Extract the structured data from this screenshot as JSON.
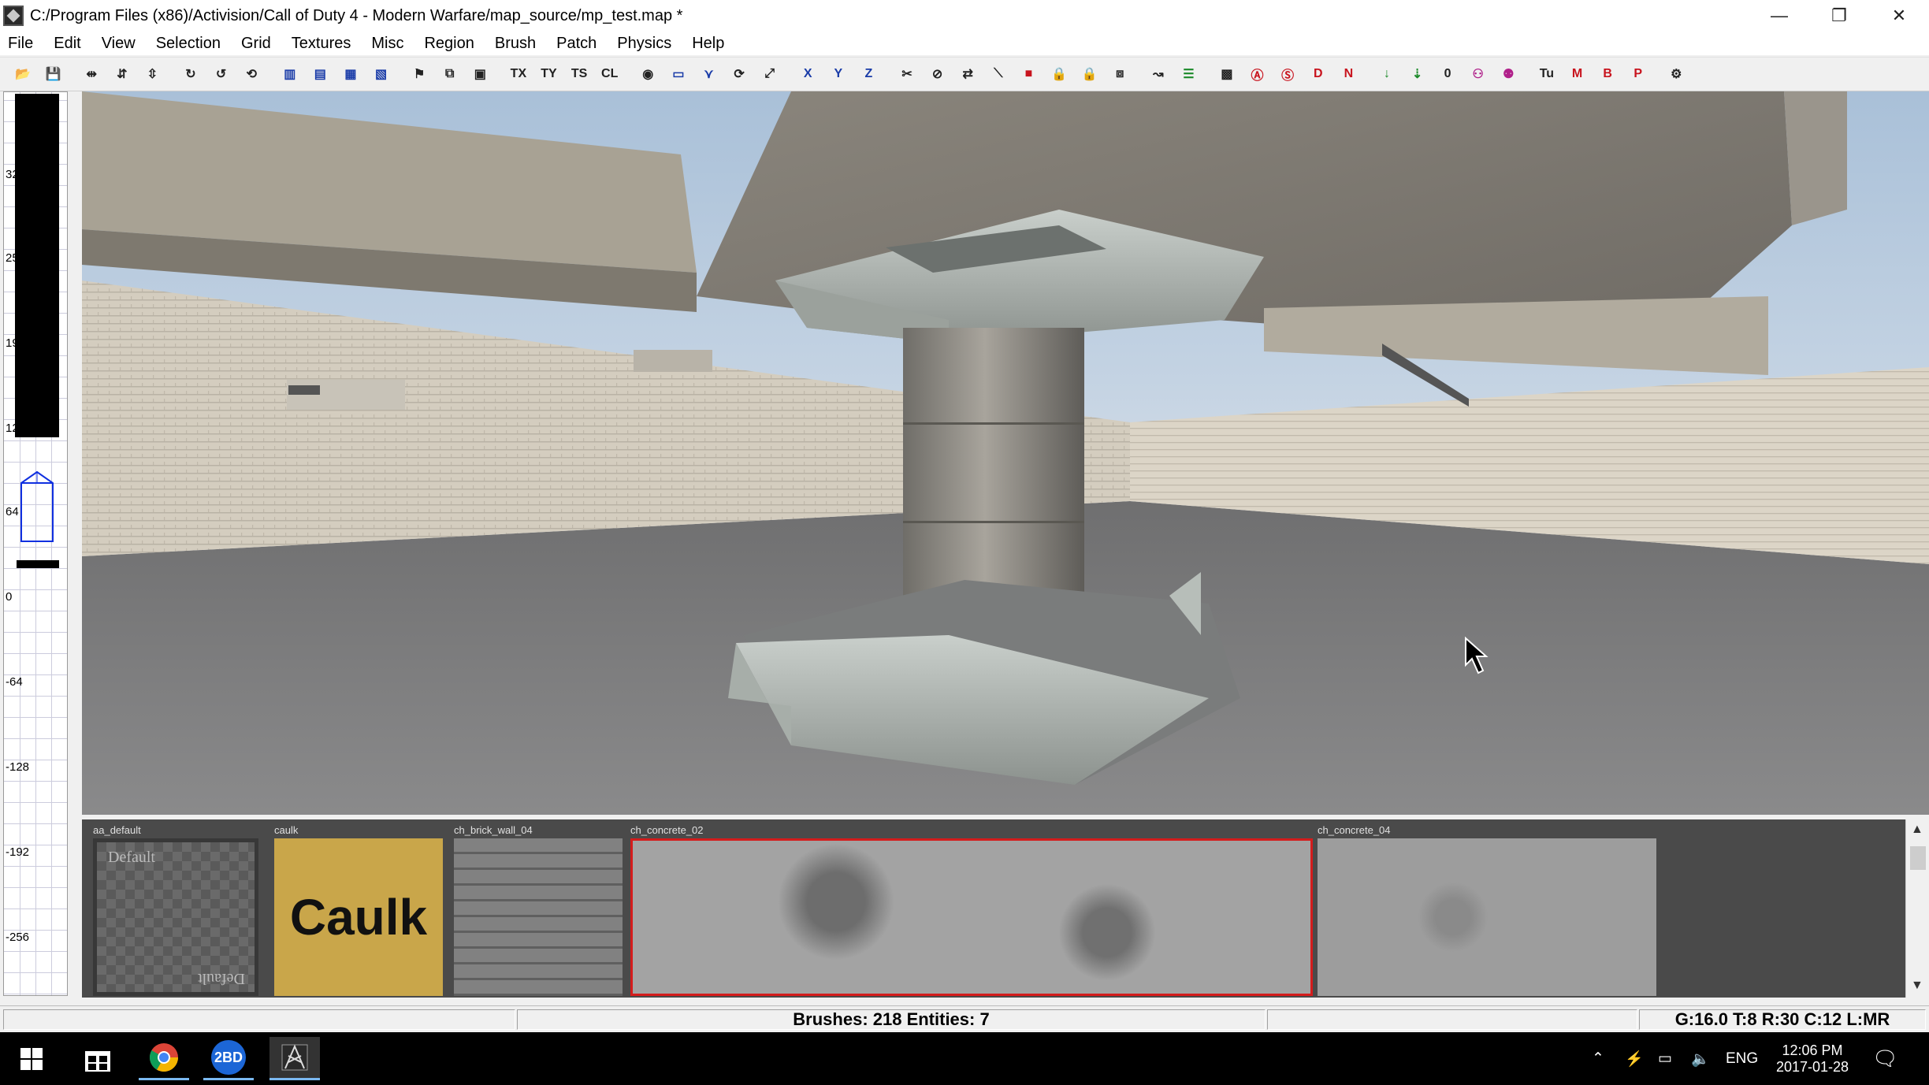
{
  "window": {
    "title": "C:/Program Files (x86)/Activision/Call of Duty 4 - Modern Warfare/map_source/mp_test.map *",
    "minimize_glyph": "—",
    "restore_glyph": "❐",
    "close_glyph": "✕"
  },
  "menu": [
    "File",
    "Edit",
    "View",
    "Selection",
    "Grid",
    "Textures",
    "Misc",
    "Region",
    "Brush",
    "Patch",
    "Physics",
    "Help"
  ],
  "toolbar": {
    "buttons": [
      {
        "name": "open-icon",
        "glyph": "📂"
      },
      {
        "name": "save-icon",
        "glyph": "💾"
      },
      {
        "name": "flip-x-icon",
        "glyph": "⇹"
      },
      {
        "name": "flip-y-icon",
        "glyph": "⇵"
      },
      {
        "name": "flip-z-icon",
        "glyph": "⇳"
      },
      {
        "name": "rotate-x-icon",
        "glyph": "↻"
      },
      {
        "name": "rotate-y-icon",
        "glyph": "↺"
      },
      {
        "name": "rotate-z-icon",
        "glyph": "⟲"
      },
      {
        "name": "select-complete-tall-icon",
        "glyph": "▥"
      },
      {
        "name": "select-touching-icon",
        "glyph": "▤"
      },
      {
        "name": "select-partial-tall-icon",
        "glyph": "▦"
      },
      {
        "name": "select-inside-icon",
        "glyph": "▧"
      },
      {
        "name": "csg-subtract-icon",
        "glyph": "⚑"
      },
      {
        "name": "csg-merge-icon",
        "glyph": "⧉"
      },
      {
        "name": "hollow-icon",
        "glyph": "▣"
      },
      {
        "name": "texture-flip-x-icon",
        "glyph": "TX"
      },
      {
        "name": "texture-flip-y-icon",
        "glyph": "TY"
      },
      {
        "name": "texture-swap-icon",
        "glyph": "TS"
      },
      {
        "name": "cycle-layer-icon",
        "glyph": "CL"
      },
      {
        "name": "texture-lock-icon",
        "glyph": "◉"
      },
      {
        "name": "camera-view-icon",
        "glyph": "▭"
      },
      {
        "name": "vertex-edit-icon",
        "glyph": "⋎"
      },
      {
        "name": "rotate-view-icon",
        "glyph": "⟳"
      },
      {
        "name": "scale-view-icon",
        "glyph": "⤢"
      },
      {
        "name": "view-x-icon",
        "glyph": "X"
      },
      {
        "name": "view-y-icon",
        "glyph": "Y"
      },
      {
        "name": "view-z-icon",
        "glyph": "Z"
      },
      {
        "name": "clipper-icon",
        "glyph": "✂"
      },
      {
        "name": "split-icon",
        "glyph": "⊘"
      },
      {
        "name": "drag-icon",
        "glyph": "⇄"
      },
      {
        "name": "make-detail-icon",
        "glyph": "⟍"
      },
      {
        "name": "entity-red-icon",
        "glyph": "■"
      },
      {
        "name": "lock-x-icon",
        "glyph": "🔒"
      },
      {
        "name": "lock-y-icon",
        "glyph": "🔒"
      },
      {
        "name": "region-icon",
        "glyph": "⧈"
      },
      {
        "name": "curve-icon",
        "glyph": "↝"
      },
      {
        "name": "entity-list-icon",
        "glyph": "☰"
      },
      {
        "name": "patch-icon",
        "glyph": "▩"
      },
      {
        "name": "filter-a-icon",
        "glyph": "Ⓐ"
      },
      {
        "name": "filter-s-icon",
        "glyph": "Ⓢ"
      },
      {
        "name": "filter-d-icon",
        "glyph": "D"
      },
      {
        "name": "filter-n-icon",
        "glyph": "N"
      },
      {
        "name": "drop-down-icon",
        "glyph": "↓"
      },
      {
        "name": "drop-down-alt-icon",
        "glyph": "⇣"
      },
      {
        "name": "zero-icon",
        "glyph": "0"
      },
      {
        "name": "people-icon",
        "glyph": "⚇"
      },
      {
        "name": "people-alt-icon",
        "glyph": "⚉"
      },
      {
        "name": "tu-icon",
        "glyph": "Tu"
      },
      {
        "name": "m-icon",
        "glyph": "M"
      },
      {
        "name": "b-icon",
        "glyph": "B"
      },
      {
        "name": "p-icon",
        "glyph": "P"
      },
      {
        "name": "compile-icon",
        "glyph": "⚙"
      }
    ]
  },
  "zview": {
    "labels": [
      "32",
      "25",
      "19",
      "12",
      "64",
      "0",
      "-64",
      "-128",
      "-192",
      "-256"
    ]
  },
  "textures": [
    {
      "name": "aa_default",
      "swatch_text": "Default",
      "swatch_text_flipped": "Default"
    },
    {
      "name": "caulk",
      "swatch_text": "Caulk"
    },
    {
      "name": "ch_brick_wall_04"
    },
    {
      "name": "ch_concrete_02"
    },
    {
      "name": "ch_concrete_04"
    }
  ],
  "status": {
    "counts": "Brushes: 218 Entities: 7",
    "grid": "G:16.0 T:8 R:30 C:12 L:MR"
  },
  "taskbar": {
    "app_badge": "2BD",
    "language": "ENG",
    "time": "12:06 PM",
    "date": "2017-01-28"
  },
  "colors": {
    "selection_red": "#d41c1c",
    "caulk_yellow": "#c9a64a",
    "zbrush_blue": "#1030e0"
  }
}
